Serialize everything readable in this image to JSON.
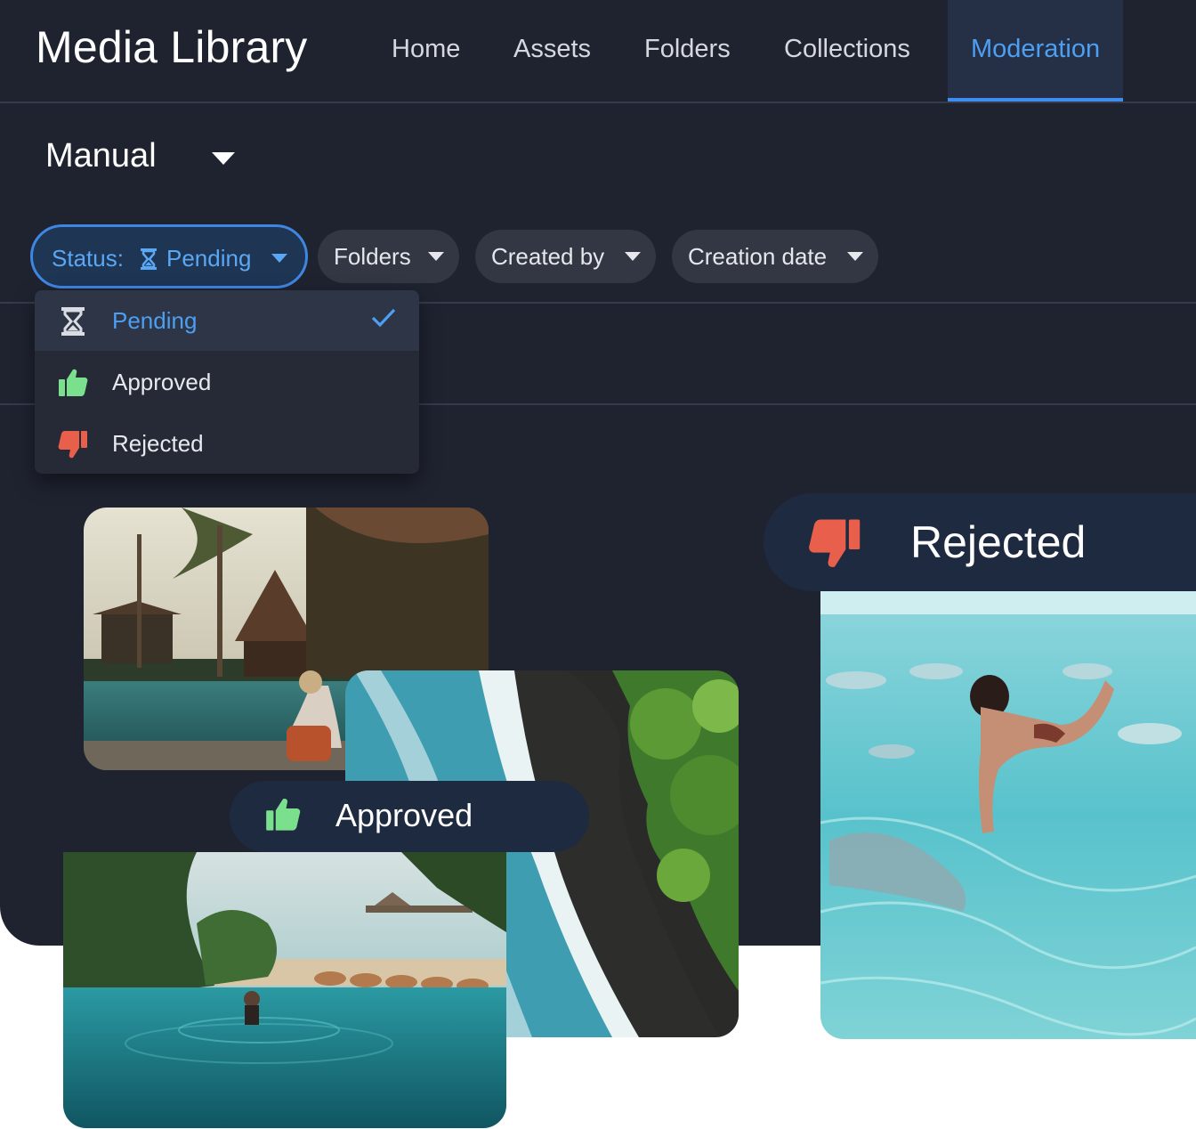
{
  "app": {
    "title": "Media Library"
  },
  "nav": {
    "tabs": [
      {
        "label": "Home"
      },
      {
        "label": "Assets"
      },
      {
        "label": "Folders"
      },
      {
        "label": "Collections"
      },
      {
        "label": "Moderation"
      }
    ],
    "active": "Moderation"
  },
  "view_select": {
    "value": "Manual"
  },
  "filters": {
    "status": {
      "prefix": "Status:",
      "value": "Pending"
    },
    "folders": {
      "label": "Folders"
    },
    "created_by": {
      "label": "Created by"
    },
    "creation_date": {
      "label": "Creation date"
    }
  },
  "status_dropdown": {
    "items": [
      {
        "label": "Pending",
        "icon": "hourglass-icon",
        "selected": true
      },
      {
        "label": "Approved",
        "icon": "thumbs-up-icon",
        "selected": false
      },
      {
        "label": "Rejected",
        "icon": "thumbs-down-icon",
        "selected": false
      }
    ]
  },
  "badges": {
    "approved": {
      "label": "Approved",
      "icon": "thumbs-up-icon",
      "color": "#7be08d"
    },
    "rejected": {
      "label": "Rejected",
      "icon": "thumbs-down-icon",
      "color": "#e8604c"
    }
  },
  "colors": {
    "background": "#1f2330",
    "accent": "#4c9ff2",
    "approved": "#7be08d",
    "rejected": "#e8604c"
  }
}
